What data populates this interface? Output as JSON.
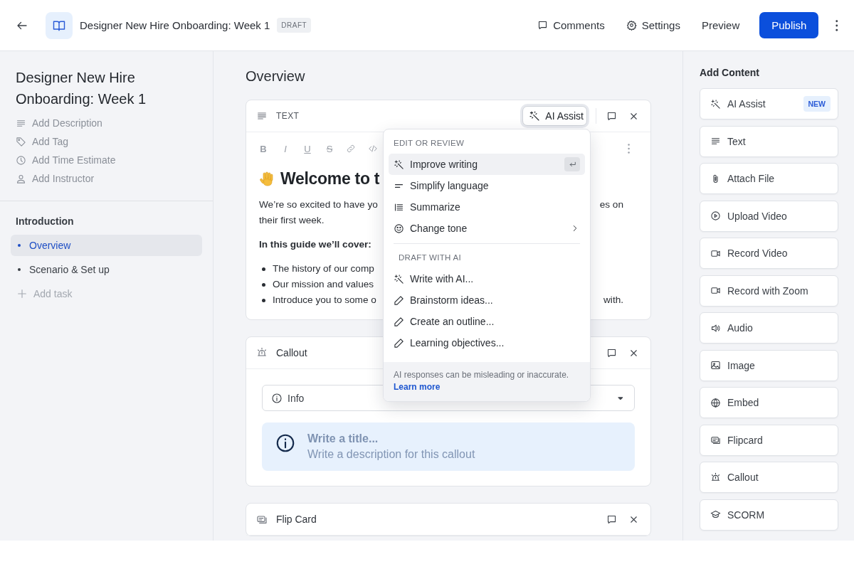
{
  "header": {
    "title": "Designer New Hire Onboarding: Week 1",
    "badge": "DRAFT",
    "actions": [
      {
        "label": "Comments"
      },
      {
        "label": "Settings"
      },
      {
        "label": "Preview"
      }
    ],
    "primary": "Publish"
  },
  "sidebar": {
    "title": "Designer New Hire Onboarding: Week 1",
    "meta": [
      "Add Description",
      "Add Tag",
      "Add Time Estimate",
      "Add Instructor"
    ],
    "section": "Introduction",
    "items": [
      {
        "label": "Overview",
        "selected": true
      },
      {
        "label": "Scenario & Set up",
        "selected": false
      }
    ],
    "add": "Add task"
  },
  "main": {
    "heading": "Overview",
    "blocks": [
      {
        "kind": "text",
        "label": "TEXT",
        "ai_button": "AI Assist",
        "format_buttons": [
          "B",
          "I",
          "U",
          "S"
        ],
        "heading": "Welcome to t",
        "lines": [
          {
            "kind": "para",
            "left": "We’re so excited to have yo",
            "right": "es on"
          },
          {
            "kind": "para",
            "left": "their first week."
          },
          {
            "kind": "bold",
            "left": "In this guide we’ll cover:"
          },
          {
            "kind": "bullet",
            "left": "The history of our comp"
          },
          {
            "kind": "bullet",
            "left": "Our mission and values"
          },
          {
            "kind": "bullet",
            "left": "Introduce you to some o",
            "right": "with."
          }
        ]
      },
      {
        "kind": "callout",
        "label": "Callout",
        "select": "Info",
        "title_placeholder": "Write a title...",
        "description_placeholder": "Write a description for this callout"
      },
      {
        "kind": "flipcard",
        "label": "Flip Card"
      }
    ]
  },
  "ai_menu": {
    "sections": [
      {
        "title": "EDIT OR REVIEW",
        "items": [
          {
            "label": "Improve writing",
            "selected": true,
            "submenu": false
          },
          {
            "label": "Simplify language",
            "selected": false,
            "submenu": false
          },
          {
            "label": "Summarize",
            "selected": false,
            "submenu": false
          },
          {
            "label": "Change tone",
            "selected": false,
            "submenu": true
          }
        ]
      },
      {
        "title": "DRAFT WITH AI",
        "items": [
          {
            "label": "Write with AI...",
            "selected": false,
            "submenu": false
          },
          {
            "label": "Brainstorm ideas...",
            "selected": false,
            "submenu": false
          },
          {
            "label": "Create an outline...",
            "selected": false,
            "submenu": false
          },
          {
            "label": "Learning objectives...",
            "selected": false,
            "submenu": false
          }
        ]
      }
    ],
    "note": "AI responses can be misleading or inaccurate.",
    "link": "Learn more"
  },
  "add_content": {
    "title": "Add Content",
    "items": [
      {
        "label": "AI Assist",
        "badge": "NEW"
      },
      {
        "label": "Text"
      },
      {
        "label": "Attach File"
      },
      {
        "label": "Upload Video"
      },
      {
        "label": "Record Video"
      },
      {
        "label": "Record with Zoom"
      },
      {
        "label": "Audio"
      },
      {
        "label": "Image"
      },
      {
        "label": "Embed"
      },
      {
        "label": "Flipcard"
      },
      {
        "label": "Callout"
      },
      {
        "label": "SCORM"
      }
    ]
  }
}
